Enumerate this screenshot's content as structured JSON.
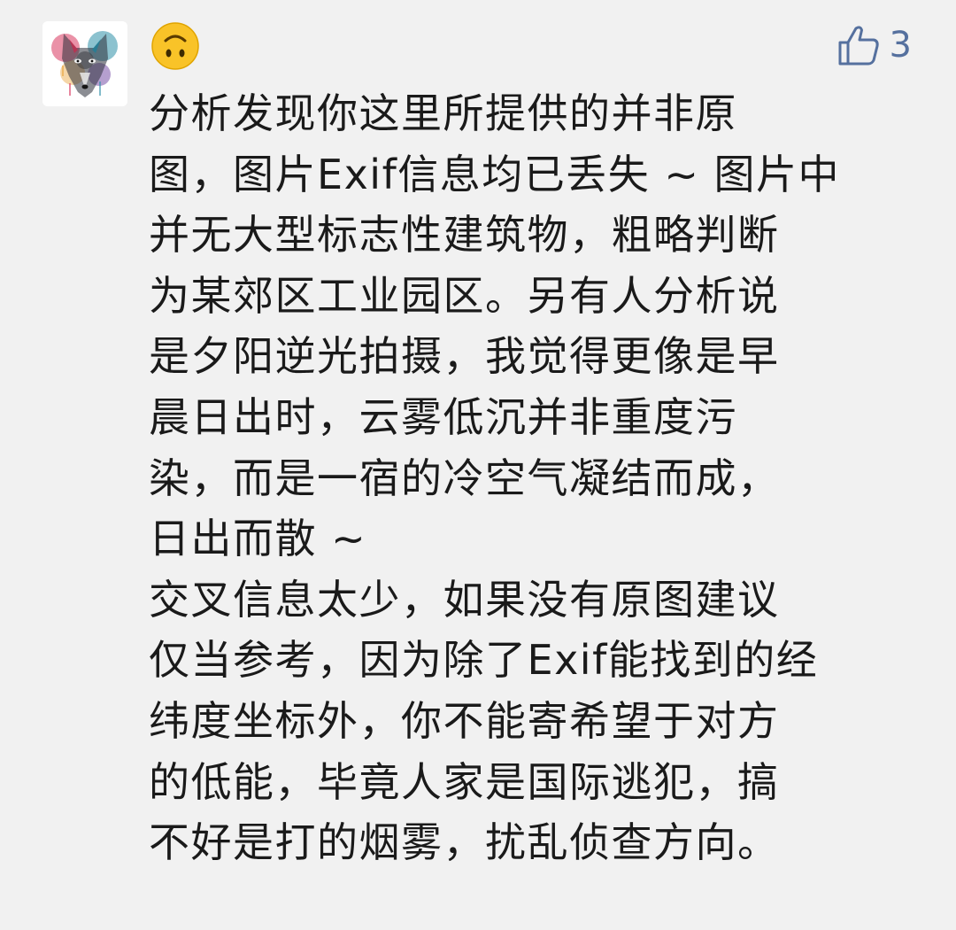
{
  "comment": {
    "username_emoji": "🙃",
    "like_count": "3",
    "lines": [
      "分析发现你这里所提供的并非原",
      "图，图片Exif信息均已丢失 ~ 图片中",
      "并无大型标志性建筑物，粗略判断",
      "为某郊区工业园区。另有人分析说",
      "是夕阳逆光拍摄，我觉得更像是早",
      "晨日出时，云雾低沉并非重度污",
      "染，而是一宿的冷空气凝结而成，",
      "日出而散 ~",
      "交叉信息太少，如果没有原图建议",
      "仅当参考，因为除了Exif能找到的经",
      "纬度坐标外，你不能寄希望于对方",
      "的低能，毕竟人家是国际逃犯，搞",
      "不好是打的烟雾，扰乱侦查方向。"
    ]
  },
  "colors": {
    "background": "#f1f1f1",
    "text": "#1a1a1a",
    "like": "#55709e",
    "emoji": "#f9c328"
  },
  "icons": {
    "avatar": "wolf-avatar-icon",
    "username": "upside-down-face-emoji-icon",
    "like": "thumbs-up-icon"
  }
}
